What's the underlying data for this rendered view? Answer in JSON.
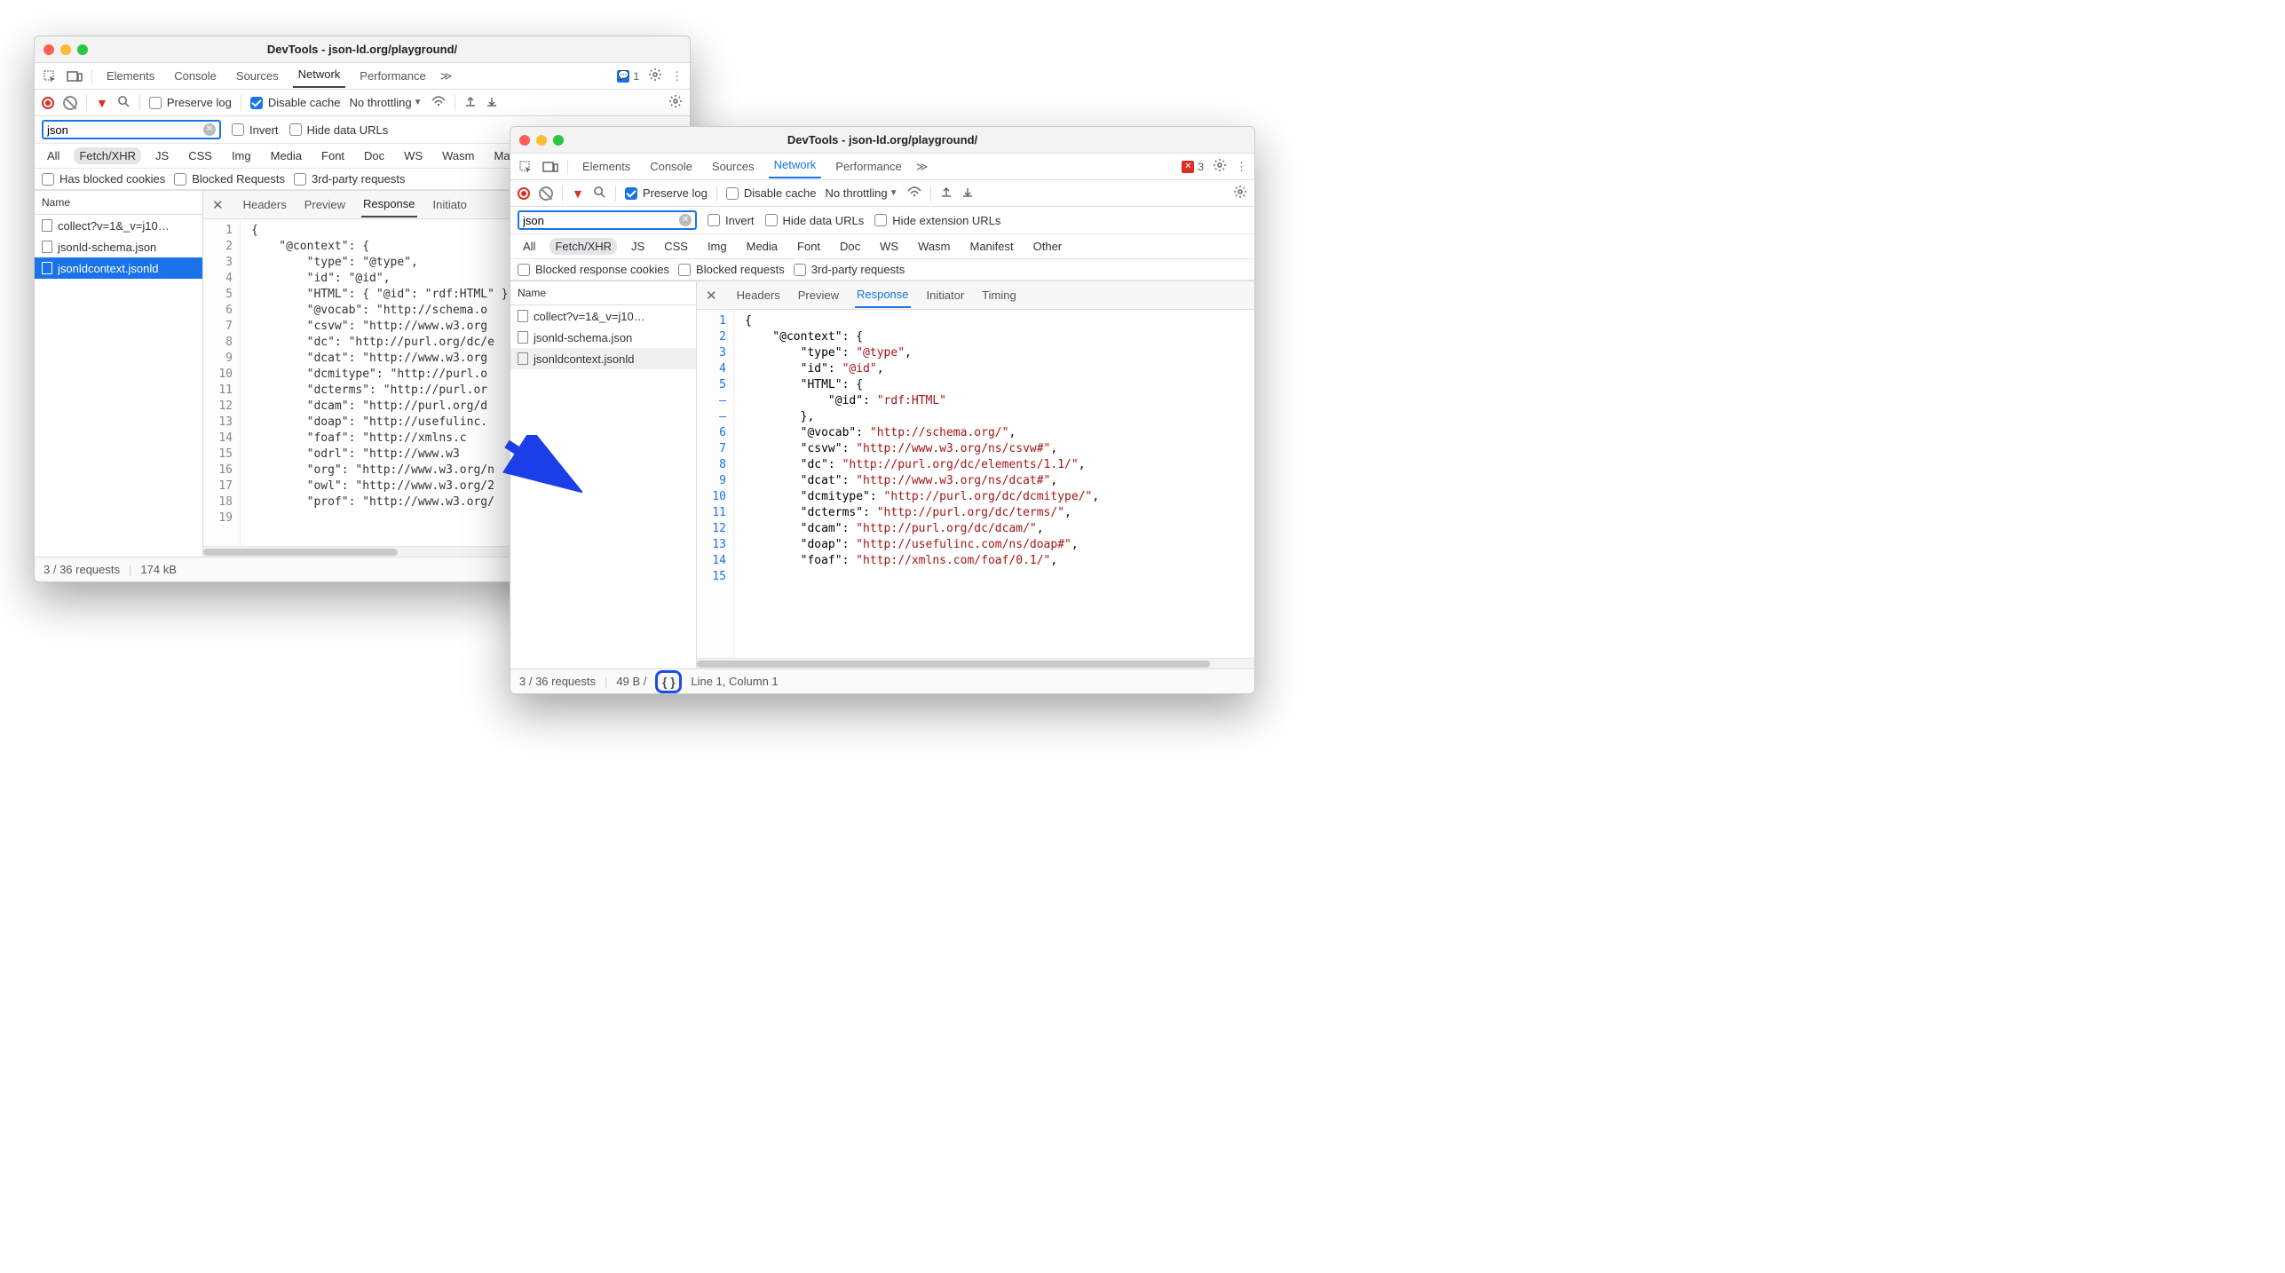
{
  "left": {
    "title": "DevTools - json-ld.org/playground/",
    "tabs": [
      "Elements",
      "Console",
      "Sources",
      "Network",
      "Performance"
    ],
    "active_tab": "Network",
    "badge_count": "1",
    "toolbar": {
      "preserve_log": "Preserve log",
      "disable_cache": "Disable cache",
      "throttling": "No throttling"
    },
    "filter": {
      "search": "json",
      "invert": "Invert",
      "hide_data_urls": "Hide data URLs"
    },
    "type_filters": [
      "All",
      "Fetch/XHR",
      "JS",
      "CSS",
      "Img",
      "Media",
      "Font",
      "Doc",
      "WS",
      "Wasm",
      "Manifest"
    ],
    "type_active": "Fetch/XHR",
    "extra_filters": [
      "Has blocked cookies",
      "Blocked Requests",
      "3rd-party requests"
    ],
    "list_header": "Name",
    "requests": [
      {
        "name": "collect?v=1&_v=j10…",
        "selected": false
      },
      {
        "name": "jsonld-schema.json",
        "selected": false
      },
      {
        "name": "jsonldcontext.jsonld",
        "selected": true
      }
    ],
    "detail_tabs": [
      "Headers",
      "Preview",
      "Response",
      "Initiato"
    ],
    "detail_active": "Response",
    "gutter": [
      "1",
      "2",
      "3",
      "4",
      "5",
      "6",
      "7",
      "8",
      "9",
      "10",
      "11",
      "12",
      "13",
      "14",
      "15",
      "16",
      "17",
      "18",
      "19"
    ],
    "code_lines": [
      "{",
      "    \"@context\": {",
      "        \"type\": \"@type\",",
      "        \"id\": \"@id\",",
      "        \"HTML\": { \"@id\": \"rdf:HTML\" }",
      "",
      "        \"@vocab\": \"http://schema.o",
      "        \"csvw\": \"http://www.w3.org",
      "        \"dc\": \"http://purl.org/dc/e",
      "        \"dcat\": \"http://www.w3.org",
      "        \"dcmitype\": \"http://purl.o",
      "        \"dcterms\": \"http://purl.or",
      "        \"dcam\": \"http://purl.org/d",
      "        \"doap\": \"http://usefulinc.",
      "        \"foaf\": \"http://xmlns.c",
      "        \"odrl\": \"http://www.w3",
      "        \"org\": \"http://www.w3.org/n",
      "        \"owl\": \"http://www.w3.org/2",
      "        \"prof\": \"http://www.w3.org/"
    ],
    "status": {
      "requests": "3 / 36 requests",
      "size": "174 kB"
    }
  },
  "right": {
    "title": "DevTools - json-ld.org/playground/",
    "tabs": [
      "Elements",
      "Console",
      "Sources",
      "Network",
      "Performance"
    ],
    "active_tab": "Network",
    "badge_count": "3",
    "toolbar": {
      "preserve_log": "Preserve log",
      "disable_cache": "Disable cache",
      "throttling": "No throttling"
    },
    "filter": {
      "search": "json",
      "invert": "Invert",
      "hide_data_urls": "Hide data URLs",
      "hide_ext_urls": "Hide extension URLs"
    },
    "type_filters": [
      "All",
      "Fetch/XHR",
      "JS",
      "CSS",
      "Img",
      "Media",
      "Font",
      "Doc",
      "WS",
      "Wasm",
      "Manifest",
      "Other"
    ],
    "type_active": "Fetch/XHR",
    "extra_filters": [
      "Blocked response cookies",
      "Blocked requests",
      "3rd-party requests"
    ],
    "list_header": "Name",
    "requests": [
      {
        "name": "collect?v=1&_v=j10…",
        "selected": false
      },
      {
        "name": "jsonld-schema.json",
        "selected": false
      },
      {
        "name": "jsonldcontext.jsonld",
        "selected": false,
        "hover": true
      }
    ],
    "detail_tabs": [
      "Headers",
      "Preview",
      "Response",
      "Initiator",
      "Timing"
    ],
    "detail_active": "Response",
    "gutter": [
      "1",
      "2",
      "3",
      "4",
      "5",
      "–",
      "–",
      "6",
      "7",
      "8",
      "9",
      "10",
      "11",
      "12",
      "13",
      "14",
      "15"
    ],
    "code_plain": [
      "{",
      "    \"@context\": {",
      "        \"type\": ",
      "        \"id\": ",
      "        \"HTML\": {",
      "            \"@id\": ",
      "        },",
      "        \"@vocab\": ",
      "        \"csvw\": ",
      "        \"dc\": ",
      "        \"dcat\": ",
      "        \"dcmitype\": ",
      "        \"dcterms\": ",
      "        \"dcam\": ",
      "        \"doap\": ",
      "        \"foaf\": "
    ],
    "code_vals": [
      "",
      "",
      "\"@type\"",
      "\"@id\"",
      "",
      "\"rdf:HTML\"",
      "",
      "\"http://schema.org/\"",
      "\"http://www.w3.org/ns/csvw#\"",
      "\"http://purl.org/dc/elements/1.1/\"",
      "\"http://www.w3.org/ns/dcat#\"",
      "\"http://purl.org/dc/dcmitype/\"",
      "\"http://purl.org/dc/terms/\"",
      "\"http://purl.org/dc/dcam/\"",
      "\"http://usefulinc.com/ns/doap#\"",
      "\"http://xmlns.com/foaf/0.1/\""
    ],
    "code_tail": [
      "",
      "",
      ",",
      ",",
      "",
      "",
      "",
      ",",
      ",",
      ",",
      ",",
      ",",
      ",",
      ",",
      ",",
      ","
    ],
    "status": {
      "requests": "3 / 36 requests",
      "size": "49 B /",
      "cursor": "Line 1, Column 1"
    },
    "pretty_label": "{ }"
  }
}
